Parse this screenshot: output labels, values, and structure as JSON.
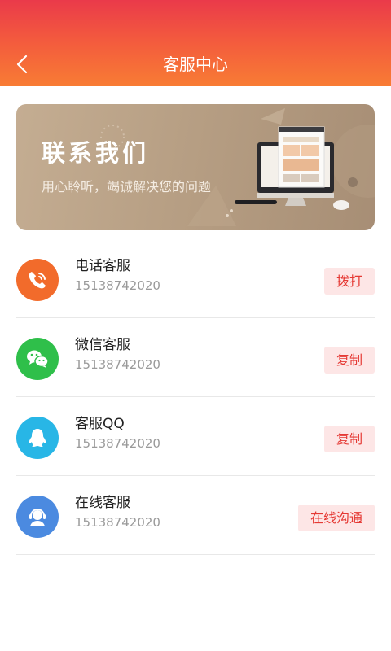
{
  "header": {
    "title": "客服中心"
  },
  "banner": {
    "title": "联系我们",
    "subtitle": "用心聆听，竭诚解决您的问题"
  },
  "contacts": [
    {
      "name": "电话客服",
      "number": "15138742020",
      "action": "拨打",
      "icon": "phone-icon",
      "color": "#f26b2b"
    },
    {
      "name": "微信客服",
      "number": "15138742020",
      "action": "复制",
      "icon": "wechat-icon",
      "color": "#2fbf4a"
    },
    {
      "name": "客服QQ",
      "number": "15138742020",
      "action": "复制",
      "icon": "qq-icon",
      "color": "#28b6e6"
    },
    {
      "name": "在线客服",
      "number": "15138742020",
      "action": "在线沟通",
      "icon": "headset-icon",
      "color": "#4b8ae0"
    }
  ],
  "colors": {
    "header_top": "#ea3a4a",
    "header_bottom": "#f87c34",
    "action_text": "#e53a35",
    "action_bg": "#fde6e6"
  }
}
